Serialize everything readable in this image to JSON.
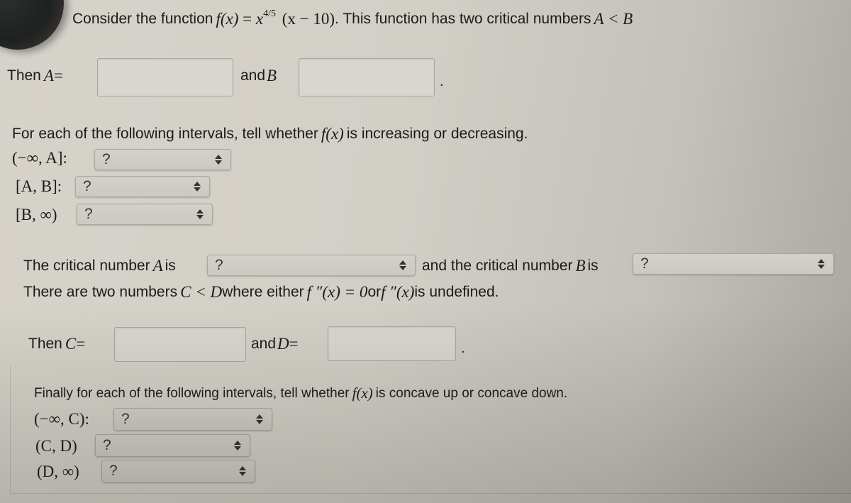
{
  "intro": {
    "text_before": "Consider the function ",
    "function_lhs": "f(x)",
    "equals": " = ",
    "base": "x",
    "exponent": "4/5",
    "factor": "(x − 10)",
    "text_after": ". This function has two critical numbers ",
    "inequality": "A < B"
  },
  "ab_row": {
    "then_label": "Then ",
    "a_var": "A",
    "eq": " =",
    "a_value": "",
    "and_label": "and ",
    "b_var": "B",
    "b_value": "",
    "period": "."
  },
  "increasing_section": {
    "prompt_before": "For each of the following intervals, tell whether ",
    "prompt_func": "f(x)",
    "prompt_after": " is increasing or decreasing.",
    "rows": [
      {
        "interval": "(−∞, A]:",
        "selected": "?"
      },
      {
        "interval": "[A, B]:",
        "selected": "?"
      },
      {
        "interval": "[B, ∞)",
        "selected": "?"
      }
    ]
  },
  "critical_row": {
    "a_label_before": "The critical number ",
    "a_var": "A",
    "a_label_after": " is",
    "a_selected": "?",
    "b_label_before": "and the critical number ",
    "b_var": "B",
    "b_label_after": " is",
    "b_selected": "?"
  },
  "cd_statement": {
    "before": "There are two numbers ",
    "inequality": "C < D",
    "middle": " where either ",
    "fpp1": "f ″(x) = 0",
    "or": " or ",
    "fpp2": "f ″(x)",
    "after": " is undefined."
  },
  "cd_row": {
    "then_label": "Then ",
    "c_var": "C",
    "eq": " =",
    "c_value": "",
    "and_label": "and ",
    "d_var": "D",
    "d_eq": " =",
    "d_value": "",
    "period": "."
  },
  "concavity_section": {
    "prompt_before": "Finally for each of the following intervals, tell whether ",
    "prompt_func": "f(x)",
    "prompt_after": " is concave up or concave down.",
    "rows": [
      {
        "interval": "(−∞, C):",
        "selected": "?"
      },
      {
        "interval": "(C, D)",
        "selected": "?"
      },
      {
        "interval": "(D, ∞)",
        "selected": "?"
      }
    ]
  }
}
